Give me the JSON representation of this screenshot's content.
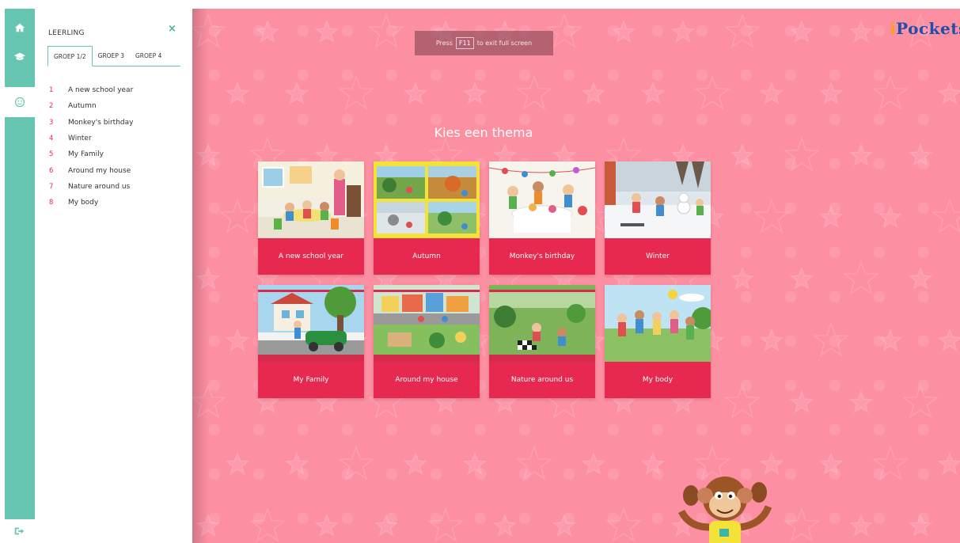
{
  "rail": {
    "items": [
      {
        "icon": "home-icon"
      },
      {
        "icon": "graduation-cap-icon"
      },
      {
        "icon": "smiley-icon",
        "active": true
      }
    ],
    "logout_icon": "logout-icon"
  },
  "sidebar": {
    "title": "LEERLING",
    "close_symbol": "×",
    "tabs": [
      {
        "label": "GROEP 1/2",
        "active": true
      },
      {
        "label": "GROEP 3"
      },
      {
        "label": "GROEP 4"
      }
    ],
    "themes": [
      {
        "num": "1",
        "label": "A new school year"
      },
      {
        "num": "2",
        "label": "Autumn"
      },
      {
        "num": "3",
        "label": "Monkey's birthday"
      },
      {
        "num": "4",
        "label": "Winter"
      },
      {
        "num": "5",
        "label": "My Family"
      },
      {
        "num": "6",
        "label": "Around my house"
      },
      {
        "num": "7",
        "label": "Nature around us"
      },
      {
        "num": "8",
        "label": "My body"
      }
    ]
  },
  "fullscreen_hint": {
    "prefix": "Press",
    "key": "F11",
    "suffix": "to exit full screen"
  },
  "brand": {
    "prefix": "i",
    "name": "Pockets"
  },
  "main": {
    "heading": "Kies een thema",
    "cards": [
      {
        "label": "A new school year",
        "image": "classroom-illustration"
      },
      {
        "label": "Autumn",
        "image": "autumn-illustration"
      },
      {
        "label": "Monkey's birthday",
        "image": "birthday-illustration"
      },
      {
        "label": "Winter",
        "image": "winter-illustration"
      },
      {
        "label": "My Family",
        "image": "family-illustration"
      },
      {
        "label": "Around my house",
        "image": "neighbourhood-illustration"
      },
      {
        "label": "Nature around us",
        "image": "park-illustration"
      },
      {
        "label": "My body",
        "image": "children-playing-illustration"
      }
    ]
  },
  "colors": {
    "rail": "#66c6b1",
    "background": "#fd8fa2",
    "card": "#e8294f",
    "accent_number": "#e8294f",
    "brand_blue": "#1f4fa8",
    "brand_orange": "#f6a21c"
  }
}
